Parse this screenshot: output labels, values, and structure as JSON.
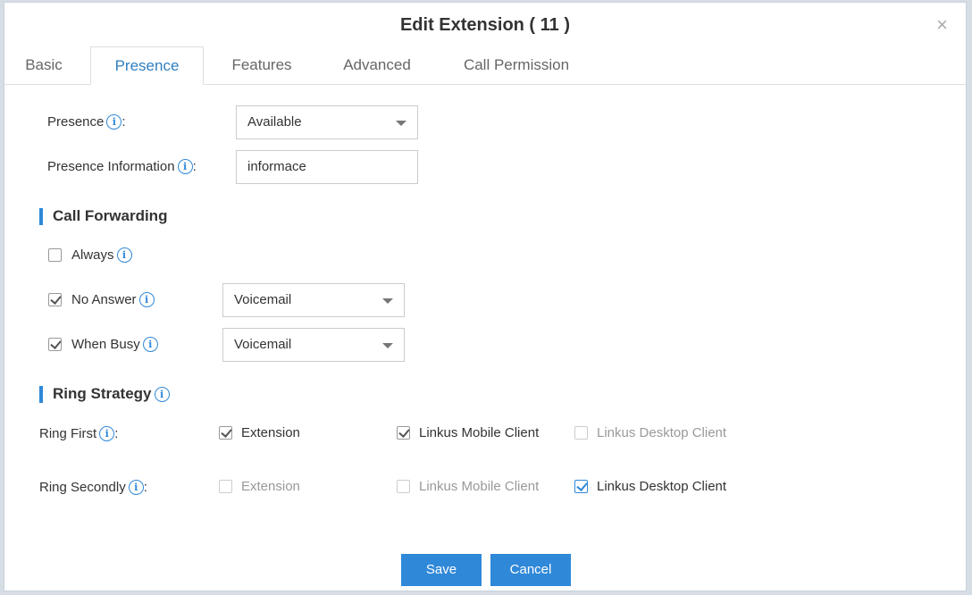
{
  "dialog": {
    "title": "Edit Extension ( 11 )",
    "close_symbol": "×"
  },
  "tabs": [
    {
      "label": "Basic",
      "active": false
    },
    {
      "label": "Presence",
      "active": true
    },
    {
      "label": "Features",
      "active": false
    },
    {
      "label": "Advanced",
      "active": false
    },
    {
      "label": "Call Permission",
      "active": false
    }
  ],
  "presence": {
    "label": "Presence",
    "value": "Available",
    "info_label": "Presence Information",
    "info_value": "informace"
  },
  "call_forwarding": {
    "title": "Call Forwarding",
    "always": {
      "label": "Always",
      "checked": false
    },
    "no_answer": {
      "label": "No Answer",
      "checked": true,
      "value": "Voicemail"
    },
    "when_busy": {
      "label": "When Busy",
      "checked": true,
      "value": "Voicemail"
    }
  },
  "ring_strategy": {
    "title": "Ring Strategy",
    "ring_first": {
      "label": "Ring First",
      "options": [
        {
          "label": "Extension",
          "checked": true,
          "enabled": true
        },
        {
          "label": "Linkus Mobile Client",
          "checked": true,
          "enabled": true
        },
        {
          "label": "Linkus Desktop Client",
          "checked": false,
          "enabled": false
        }
      ]
    },
    "ring_secondly": {
      "label": "Ring Secondly",
      "options": [
        {
          "label": "Extension",
          "checked": false,
          "enabled": false
        },
        {
          "label": "Linkus Mobile Client",
          "checked": false,
          "enabled": false
        },
        {
          "label": "Linkus Desktop Client",
          "checked": true,
          "enabled": true
        }
      ]
    }
  },
  "buttons": {
    "save": "Save",
    "cancel": "Cancel"
  },
  "colors": {
    "accent": "#2f88d8",
    "active_tab_text": "#2f7fc0"
  },
  "icons": {
    "info": "info-circle-icon",
    "close": "close-icon",
    "dropdown": "chevron-down-icon",
    "checkbox": "checkbox-icon"
  }
}
